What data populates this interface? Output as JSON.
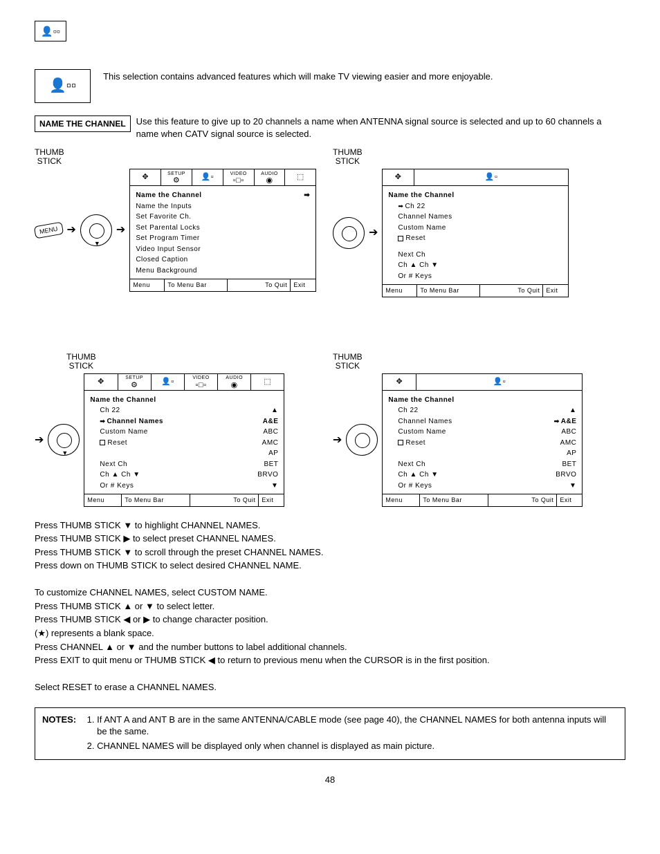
{
  "page_number": "48",
  "intro_text": "This selection contains advanced features which will make TV viewing easier and more enjoyable.",
  "feature_label": "NAME THE CHANNEL",
  "feature_desc": "Use this feature to give up to 20 channels a name when ANTENNA signal source is selected and up to 60 channels a name when CATV signal source is selected.",
  "thumb_label_1": "THUMB",
  "thumb_label_2": "STICK",
  "menu_btn": "MENU",
  "tabs": {
    "setup": "SETUP",
    "custom": "",
    "video": "VIDEO",
    "audio": "AUDIO",
    "blank": ""
  },
  "tab_icons": {
    "t0": "✥",
    "t1": "⚙",
    "t2": "👤▫",
    "t3": "▫□▫",
    "t4": "◉",
    "t5": "⬚"
  },
  "screen1": {
    "title": "Name the Channel",
    "items": [
      "Name the Inputs",
      "Set Favorite Ch.",
      "Set Parental Locks",
      "Set Program Timer",
      "Video Input Sensor",
      "Closed Caption",
      "Menu Background"
    ]
  },
  "screen2": {
    "title": "Name the Channel",
    "ch": "Ch 22",
    "items": [
      "Channel Names",
      "Custom Name"
    ],
    "reset": "Reset",
    "next": "Next Ch",
    "chup": "Ch ▲ Ch ▼",
    "ork": "Or # Keys"
  },
  "screen3": {
    "title": "Name the Channel",
    "ch": "Ch 22",
    "sel": "Channel Names",
    "custom": "Custom Name",
    "reset": "Reset",
    "names": [
      "A&E",
      "ABC",
      "AMC",
      "AP",
      "BET",
      "BRVO"
    ],
    "next": "Next Ch",
    "chup": "Ch ▲ Ch ▼",
    "ork": "Or # Keys"
  },
  "screen4": {
    "title": "Name the Channel",
    "ch": "Ch 22",
    "sel": "Channel Names",
    "selval": "A&E",
    "custom": "Custom Name",
    "reset": "Reset",
    "names": [
      "A&E",
      "ABC",
      "AMC",
      "AP",
      "BET",
      "BRVO"
    ],
    "next": "Next Ch",
    "chup": "Ch ▲ Ch ▼",
    "ork": "Or # Keys"
  },
  "foot": {
    "menu": "Menu",
    "tomenu": "To Menu Bar",
    "toquit": "To Quit",
    "exit": "Exit"
  },
  "instructions": {
    "l1": "Press THUMB STICK  ▼ to highlight CHANNEL NAMES.",
    "l2": "Press THUMB STICK ▶ to select preset CHANNEL NAMES.",
    "l3": "Press THUMB STICK ▼ to scroll through the preset CHANNEL NAMES.",
    "l4": "Press down on THUMB STICK to select desired CHANNEL NAME.",
    "l5": "To customize CHANNEL NAMES, select CUSTOM NAME.",
    "l6": "Press THUMB STICK ▲ or ▼ to select letter.",
    "l7": "Press THUMB STICK ◀ or ▶ to change character position.",
    "l8": "(★) represents a blank space.",
    "l9": "Press CHANNEL ▲ or ▼  and the number buttons to label additional channels.",
    "l10": "Press EXIT to quit menu or THUMB STICK ◀ to return to previous menu when the CURSOR is in the first position.",
    "l11": "Select RESET to erase a CHANNEL NAMES."
  },
  "notes_label": "NOTES:",
  "notes": {
    "n1": "If ANT A and ANT B are in the same ANTENNA/CABLE mode (see page 40), the CHANNEL NAMES for both antenna inputs will be the same.",
    "n2": "CHANNEL NAMES will be displayed only when channel is displayed as main picture."
  }
}
